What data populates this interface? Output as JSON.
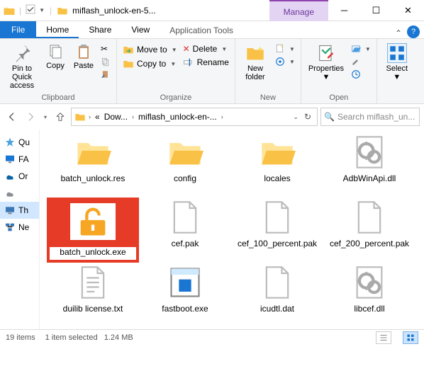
{
  "window": {
    "title": "miflash_unlock-en-5...",
    "context_tab_group": "Manage"
  },
  "tabs": {
    "file": "File",
    "home": "Home",
    "share": "Share",
    "view": "View",
    "app_tools": "Application Tools"
  },
  "ribbon": {
    "clipboard": {
      "pin": "Pin to Quick\naccess",
      "copy": "Copy",
      "paste": "Paste",
      "label": "Clipboard"
    },
    "organize": {
      "move_to": "Move to",
      "copy_to": "Copy to",
      "delete": "Delete",
      "rename": "Rename",
      "label": "Organize"
    },
    "new": {
      "new_folder": "New\nfolder",
      "label": "New"
    },
    "open": {
      "properties": "Properties",
      "label": "Open"
    },
    "select": {
      "select": "Select",
      "label": ""
    }
  },
  "address": {
    "crumbs": [
      "Dow...",
      "miflash_unlock-en-..."
    ]
  },
  "search": {
    "placeholder": "Search miflash_un..."
  },
  "tree": {
    "items": [
      {
        "label": "Qu",
        "icon": "star"
      },
      {
        "label": "FA",
        "icon": "desktop"
      },
      {
        "label": "Or",
        "icon": "onedrive"
      },
      {
        "label": "",
        "icon": "onedrive-grey"
      },
      {
        "label": "Th",
        "icon": "pc",
        "selected": true
      },
      {
        "label": "Ne",
        "icon": "network"
      }
    ]
  },
  "files": [
    {
      "name": "batch_unlock.res",
      "type": "folder"
    },
    {
      "name": "config",
      "type": "folder"
    },
    {
      "name": "locales",
      "type": "folder"
    },
    {
      "name": "AdbWinApi.dll",
      "type": "dll"
    },
    {
      "name": "batch_unlock.exe",
      "type": "unlock-exe",
      "highlight": true
    },
    {
      "name": "cef.pak",
      "type": "blank"
    },
    {
      "name": "cef_100_percent.pak",
      "type": "blank"
    },
    {
      "name": "cef_200_percent.pak",
      "type": "blank"
    },
    {
      "name": "duilib license.txt",
      "type": "txt"
    },
    {
      "name": "fastboot.exe",
      "type": "exe"
    },
    {
      "name": "icudtl.dat",
      "type": "blank"
    },
    {
      "name": "libcef.dll",
      "type": "dll"
    }
  ],
  "status": {
    "count": "19 items",
    "selection": "1 item selected",
    "size": "1.24 MB"
  }
}
